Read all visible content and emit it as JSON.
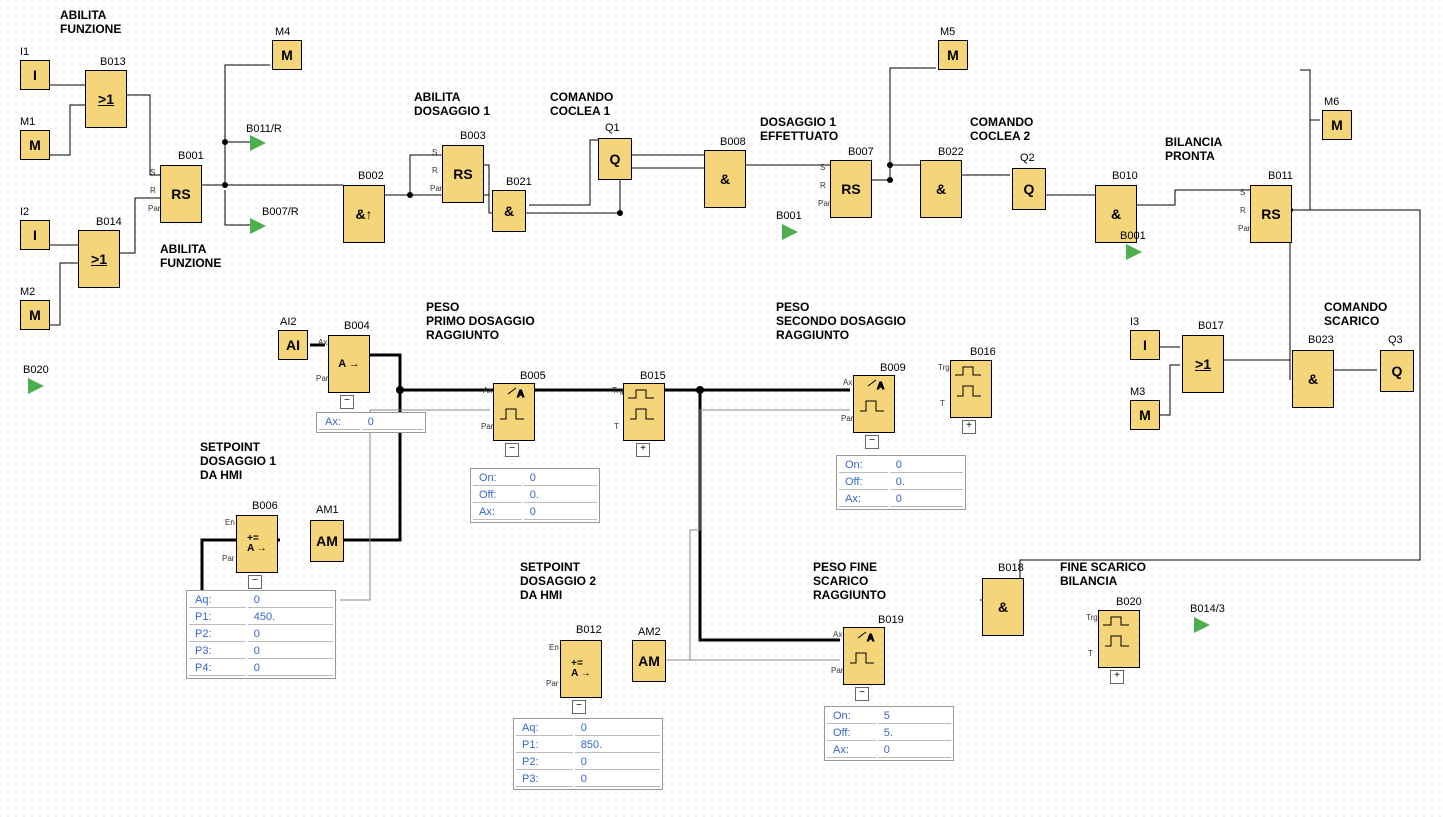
{
  "titles": {
    "abilita_funzione_1": "ABILITA\nFUNZIONE",
    "abilita_funzione_2": "ABILITA\nFUNZIONE",
    "abilita_dosaggio_1": "ABILITA\nDOSAGGIO 1",
    "comando_coclea_1": "COMANDO\nCOCLEA 1",
    "dosaggio_1_effettuato": "DOSAGGIO 1\nEFFETTUATO",
    "comando_coclea_2": "COMANDO\nCOCLEA 2",
    "bilancia_pronta": "BILANCIA\nPRONTA",
    "peso_primo": "PESO\nPRIMO DOSAGGIO\nRAGGIUNTO",
    "peso_secondo": "PESO\nSECONDO DOSAGGIO\nRAGGIUNTO",
    "setpoint_1": "SETPOINT\nDOSAGGIO 1\nDA HMI",
    "setpoint_2": "SETPOINT\nDOSAGGIO 2\nDA HMI",
    "peso_fine": "PESO FINE\nSCARICO\nRAGGIUNTO",
    "fine_scarico": "FINE SCARICO\nBILANCIA",
    "comando_scarico": "COMANDO\nSCARICO"
  },
  "blocks": {
    "I1": {
      "id": "I1",
      "label": "I"
    },
    "I2": {
      "id": "I2",
      "label": "I"
    },
    "I3": {
      "id": "I3",
      "label": "I"
    },
    "M1": {
      "id": "M1",
      "label": "M"
    },
    "M2": {
      "id": "M2",
      "label": "M"
    },
    "M3": {
      "id": "M3",
      "label": "M"
    },
    "M4": {
      "id": "M4",
      "label": "M"
    },
    "M5": {
      "id": "M5",
      "label": "M"
    },
    "M6": {
      "id": "M6",
      "label": "M"
    },
    "AI2": {
      "id": "AI2",
      "label": "AI"
    },
    "Q1": {
      "id": "Q1",
      "label": "Q"
    },
    "Q2": {
      "id": "Q2",
      "label": "Q"
    },
    "Q3": {
      "id": "Q3",
      "label": "Q"
    },
    "B001": {
      "id": "B001",
      "label": "RS"
    },
    "B002": {
      "id": "B002",
      "label": "&↑"
    },
    "B003": {
      "id": "B003",
      "label": "RS"
    },
    "B004": {
      "id": "B004",
      "label": "A →"
    },
    "B005": {
      "id": "B005",
      "label": ""
    },
    "B006": {
      "id": "B006",
      "label": "+=\nA →"
    },
    "B007": {
      "id": "B007",
      "label": "RS"
    },
    "B008": {
      "id": "B008",
      "label": "&"
    },
    "B009": {
      "id": "B009",
      "label": ""
    },
    "B010": {
      "id": "B010",
      "label": "&"
    },
    "B011": {
      "id": "B011",
      "label": "RS"
    },
    "B012": {
      "id": "B012",
      "label": "+=\nA →"
    },
    "B013": {
      "id": "B013",
      "label": ">1"
    },
    "B014": {
      "id": "B014",
      "label": ">1"
    },
    "B015": {
      "id": "B015",
      "label": ""
    },
    "B016": {
      "id": "B016",
      "label": ""
    },
    "B017": {
      "id": "B017",
      "label": ">1"
    },
    "B018": {
      "id": "B018",
      "label": "&"
    },
    "B019": {
      "id": "B019",
      "label": ""
    },
    "B020": {
      "id": "B020",
      "label": ""
    },
    "B021": {
      "id": "B021",
      "label": "&"
    },
    "B022": {
      "id": "B022",
      "label": "&"
    },
    "B023": {
      "id": "B023",
      "label": "&"
    },
    "AM1": {
      "id": "AM1",
      "label": "AM"
    },
    "AM2": {
      "id": "AM2",
      "label": "AM"
    }
  },
  "flags": {
    "f1": "B011/R",
    "f2": "B007/R",
    "f3": "B001",
    "f4": "B001",
    "f5": "B020",
    "f6": "B014/3"
  },
  "params": {
    "p_b004": {
      "rows": [
        [
          "Ax:",
          "0"
        ]
      ]
    },
    "p_b005": {
      "rows": [
        [
          "On:",
          "0"
        ],
        [
          "Off:",
          "0."
        ],
        [
          "Ax:",
          "0"
        ]
      ]
    },
    "p_b006": {
      "rows": [
        [
          "Aq:",
          "0"
        ],
        [
          "P1:",
          "450."
        ],
        [
          "P2:",
          "0"
        ],
        [
          "P3:",
          "0"
        ],
        [
          "P4:",
          "0"
        ]
      ]
    },
    "p_b009": {
      "rows": [
        [
          "On:",
          "0"
        ],
        [
          "Off:",
          "0."
        ],
        [
          "Ax:",
          "0"
        ]
      ]
    },
    "p_b012": {
      "rows": [
        [
          "Aq:",
          "0"
        ],
        [
          "P1:",
          "850."
        ],
        [
          "P2:",
          "0"
        ],
        [
          "P3:",
          "0"
        ]
      ]
    },
    "p_b019": {
      "rows": [
        [
          "On:",
          "5"
        ],
        [
          "Off:",
          "5."
        ],
        [
          "Ax:",
          "0"
        ]
      ]
    }
  }
}
